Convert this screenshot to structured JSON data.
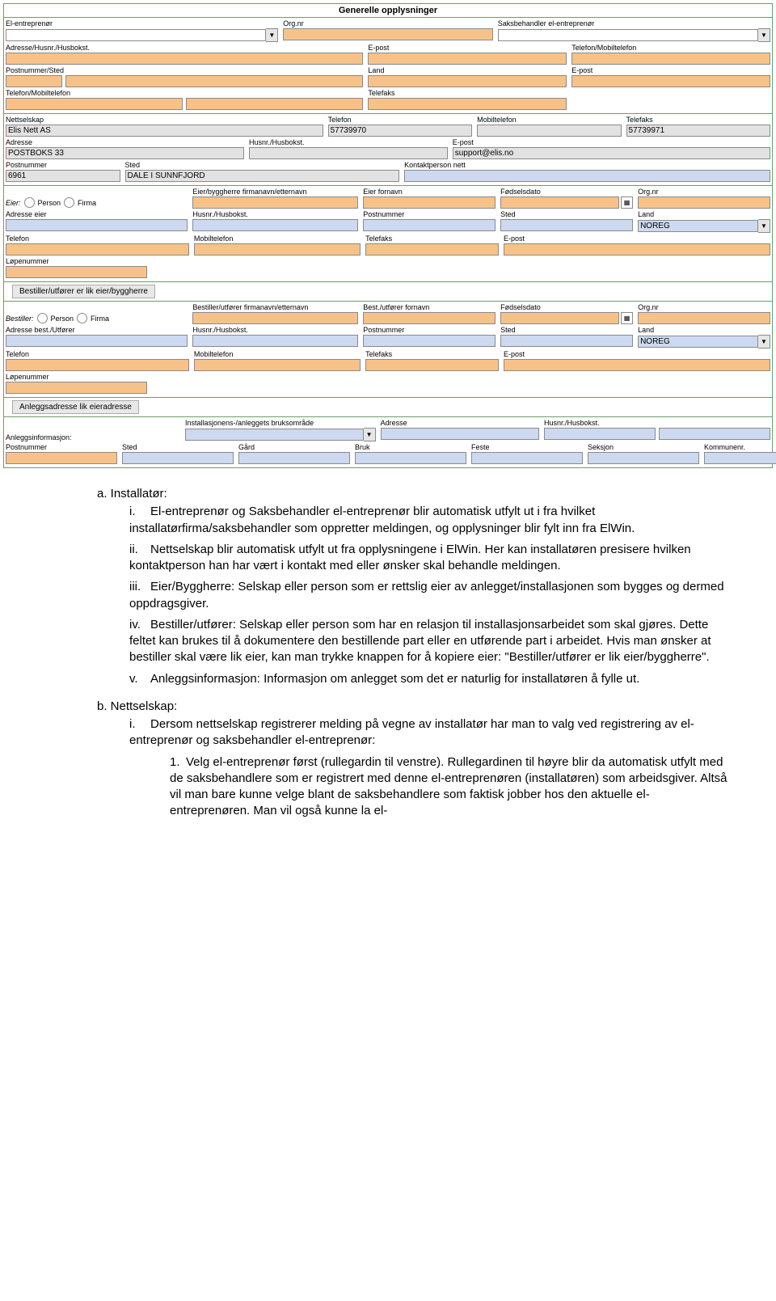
{
  "form_title": "Generelle opplysninger",
  "s1": {
    "el_entr": "El-entreprenør",
    "orgnr": "Org.nr",
    "saksbeh": "Saksbehandler el-entreprenør",
    "adresse": "Adresse/Husnr./Husbokst.",
    "epost": "E-post",
    "tele_mob": "Telefon/Mobiltelefon",
    "post_sted": "Postnummer/Sted",
    "land": "Land",
    "telefaks": "Telefaks"
  },
  "s2": {
    "nettselskap": "Nettselskap",
    "telefon": "Telefon",
    "mobiltelefon": "Mobiltelefon",
    "telefaks": "Telefaks",
    "adresse": "Adresse",
    "husnr": "Husnr./Husbokst.",
    "epost": "E-post",
    "postnr": "Postnummer",
    "sted": "Sted",
    "kontakt": "Kontaktperson nett",
    "v_nettselskap": "Elis Nett AS",
    "v_telefon": "57739970",
    "v_telefaks": "57739971",
    "v_adresse": "POSTBOKS 33",
    "v_epost": "support@elis.no",
    "v_postnr": "6961",
    "v_sted": "DALE I SUNNFJORD"
  },
  "s3": {
    "eier": "Eier:",
    "person": "Person",
    "firma": "Firma",
    "firmanavn": "Eier/byggherre firmanavn/etternavn",
    "fornavn": "Eier fornavn",
    "fodsel": "Fødselsdato",
    "orgnr": "Org.nr",
    "adresse_eier": "Adresse eier",
    "husnr": "Husnr./Husbokst.",
    "postnr": "Postnummer",
    "sted": "Sted",
    "land": "Land",
    "telefon": "Telefon",
    "mobil": "Mobiltelefon",
    "telefaks": "Telefaks",
    "epost": "E-post",
    "lopenr": "Løpenummer",
    "v_land": "NOREG"
  },
  "btn_bestiller": "Bestiller/utfører er lik eier/byggherre",
  "s4": {
    "bestiller": "Bestiller:",
    "person": "Person",
    "firma": "Firma",
    "firmanavn": "Bestiller/utfører firmanavn/etternavn",
    "fornavn": "Best./utfører fornavn",
    "fodsel": "Fødselsdato",
    "orgnr": "Org.nr",
    "adresse": "Adresse best./Utfører",
    "husnr": "Husnr./Husbokst.",
    "postnr": "Postnummer",
    "sted": "Sted",
    "land": "Land",
    "telefon": "Telefon",
    "mobil": "Mobiltelefon",
    "telefaks": "Telefaks",
    "epost": "E-post",
    "lopenr": "Løpenummer",
    "v_land": "NOREG"
  },
  "btn_anlegg": "Anleggsadresse lik eieradresse",
  "s5": {
    "info": "Anleggsinformasjon:",
    "bruks": "Installasjonens-/anleggets bruksområde",
    "adresse": "Adresse",
    "husnr": "Husnr./Husbokst.",
    "postnr": "Postnummer",
    "sted": "Sted",
    "gard": "Gård",
    "bruk": "Bruk",
    "feste": "Feste",
    "seksjon": "Seksjon",
    "kommunenr": "Kommunenr."
  },
  "txt": {
    "a": "a.  Installatør:",
    "a_i": "El-entreprenør og Saksbehandler el-entreprenør blir automatisk utfylt ut i fra hvilket installatørfirma/saksbehandler som oppretter meldingen, og opplysninger blir fylt inn fra ElWin.",
    "a_ii": "Nettselskap blir automatisk utfylt ut fra opplysningene i ElWin. Her kan installatøren presisere hvilken kontaktperson han har vært i kontakt med eller ønsker skal behandle meldingen.",
    "a_iii": "Eier/Byggherre: Selskap eller person som er rettslig eier av anlegget/installasjonen som bygges og dermed oppdragsgiver.",
    "a_iv": "Bestiller/utfører: Selskap eller person som har en relasjon til installasjonsarbeidet som skal gjøres. Dette feltet kan brukes til å dokumentere den bestillende part eller en utførende part i arbeidet. Hvis man ønsker at bestiller skal være lik eier, kan man trykke knappen for å kopiere eier: \"Bestiller/utfører er lik eier/byggherre\".",
    "a_v": "Anleggsinformasjon: Informasjon om anlegget som det er naturlig for installatøren å fylle ut.",
    "b": "b.  Nettselskap:",
    "b_i": "Dersom nettselskap registrerer melding på vegne av installatør har man to valg ved registrering av el-entreprenør og saksbehandler el-entreprenør:",
    "b_i_1": "Velg el-entreprenør først (rullegardin til venstre). Rullegardinen til høyre blir da automatisk utfylt med de saksbehandlere som er registrert med denne el-entreprenøren (installatøren) som arbeidsgiver. Altså vil man bare kunne velge blant de saksbehandlere som faktisk jobber hos den aktuelle el-entreprenøren. Man vil også kunne la el-"
  }
}
